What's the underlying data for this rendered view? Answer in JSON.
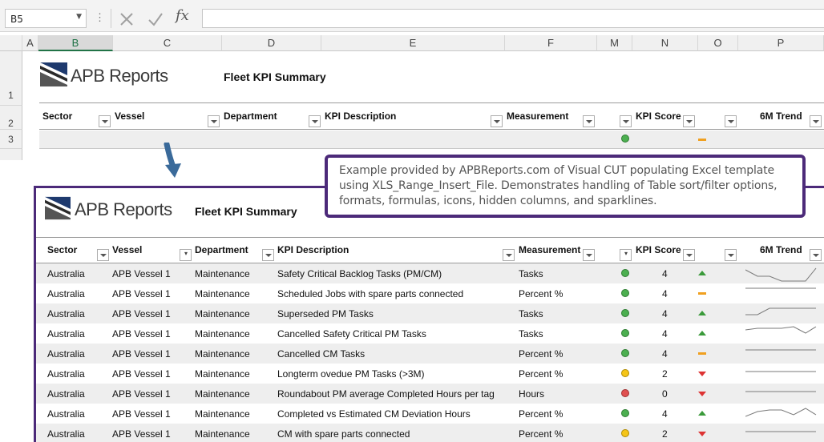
{
  "formula_bar": {
    "name_box": "B5",
    "formula": ""
  },
  "columns": [
    "A",
    "B",
    "C",
    "D",
    "E",
    "F",
    "M",
    "N",
    "O",
    "P"
  ],
  "row_numbers": [
    "1",
    "2",
    "3"
  ],
  "brand": "APB Reports",
  "report_title": "Fleet KPI Summary",
  "headers": {
    "sector": "Sector",
    "vessel": "Vessel",
    "department": "Department",
    "kpi_description": "KPI Description",
    "measurement": "Measurement",
    "kpi_score": "KPI Score",
    "trend": "6M Trend"
  },
  "callout_text": "Example provided by APBReports.com of Visual CUT populating Excel template using XLS_Range_Insert_File. Demonstrates handling of Table sort/filter options, formats, formulas, icons, hidden columns, and sparklines.",
  "colors": {
    "green": "#4caf50",
    "yellow": "#f5c518",
    "red": "#e05050",
    "accent": "#4c2a79",
    "row_alt": "#eeeeee"
  },
  "rows": [
    {
      "sector": "Australia",
      "vessel": "APB Vessel 1",
      "department": "Maintenance",
      "kpi": "Safety Critical Backlog Tasks (PM/CM)",
      "measurement": "Tasks",
      "status": "green",
      "score": "4",
      "trend": "up"
    },
    {
      "sector": "Australia",
      "vessel": "APB Vessel 1",
      "department": "Maintenance",
      "kpi": "Scheduled Jobs with spare parts connected",
      "measurement": "Percent %",
      "status": "green",
      "score": "4",
      "trend": "flat"
    },
    {
      "sector": "Australia",
      "vessel": "APB Vessel 1",
      "department": "Maintenance",
      "kpi": "Superseded PM Tasks",
      "measurement": "Tasks",
      "status": "green",
      "score": "4",
      "trend": "up"
    },
    {
      "sector": "Australia",
      "vessel": "APB Vessel 1",
      "department": "Maintenance",
      "kpi": "Cancelled Safety Critical PM Tasks",
      "measurement": "Tasks",
      "status": "green",
      "score": "4",
      "trend": "up"
    },
    {
      "sector": "Australia",
      "vessel": "APB Vessel 1",
      "department": "Maintenance",
      "kpi": "Cancelled CM Tasks",
      "measurement": "Percent %",
      "status": "green",
      "score": "4",
      "trend": "flat"
    },
    {
      "sector": "Australia",
      "vessel": "APB Vessel 1",
      "department": "Maintenance",
      "kpi": "Longterm ovedue PM Tasks (>3M)",
      "measurement": "Percent %",
      "status": "yellow",
      "score": "2",
      "trend": "down"
    },
    {
      "sector": "Australia",
      "vessel": "APB Vessel 1",
      "department": "Maintenance",
      "kpi": "Roundabout PM average Completed Hours per tag",
      "measurement": "Hours",
      "status": "red",
      "score": "0",
      "trend": "down"
    },
    {
      "sector": "Australia",
      "vessel": "APB Vessel 1",
      "department": "Maintenance",
      "kpi": "Completed vs Estimated CM Deviation Hours",
      "measurement": "Percent %",
      "status": "green",
      "score": "4",
      "trend": "up"
    },
    {
      "sector": "Australia",
      "vessel": "APB Vessel 1",
      "department": "Maintenance",
      "kpi": "CM with spare parts connected",
      "measurement": "Percent %",
      "status": "yellow",
      "score": "2",
      "trend": "down"
    }
  ]
}
